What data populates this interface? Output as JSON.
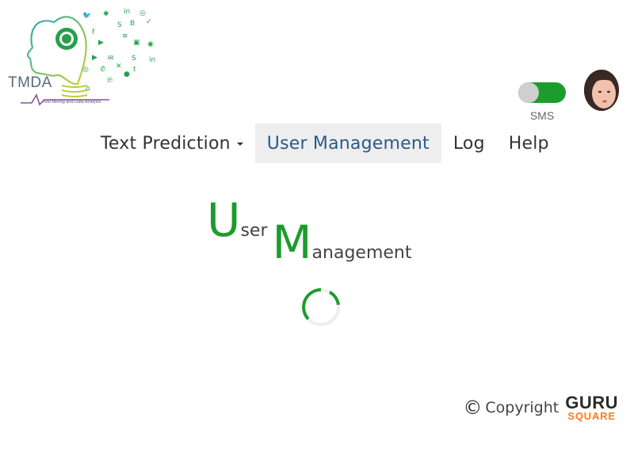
{
  "logo": {
    "name": "TMDA",
    "subtitle": "Text Mining and Data Analysis"
  },
  "sms_toggle": {
    "label": "SMS",
    "state": "on",
    "accent_color": "#1e9b2f"
  },
  "nav": {
    "items": [
      {
        "label": "Text Prediction",
        "has_dropdown": true,
        "active": false
      },
      {
        "label": "User Management",
        "has_dropdown": false,
        "active": true
      },
      {
        "label": "Log",
        "has_dropdown": false,
        "active": false
      },
      {
        "label": "Help",
        "has_dropdown": false,
        "active": false
      }
    ]
  },
  "page_title": {
    "first_initial": "U",
    "first_rest": "ser",
    "second_initial": "M",
    "second_rest": "anagement",
    "accent_color": "#1e9b2f"
  },
  "loading": {
    "icon": "loading-spinner-icon"
  },
  "footer": {
    "copyright_symbol": "©",
    "copyright_text": "Copyright",
    "brand_top": "GURU",
    "brand_bottom": "SQUARE",
    "brand_accent": "#ff7a1a"
  }
}
